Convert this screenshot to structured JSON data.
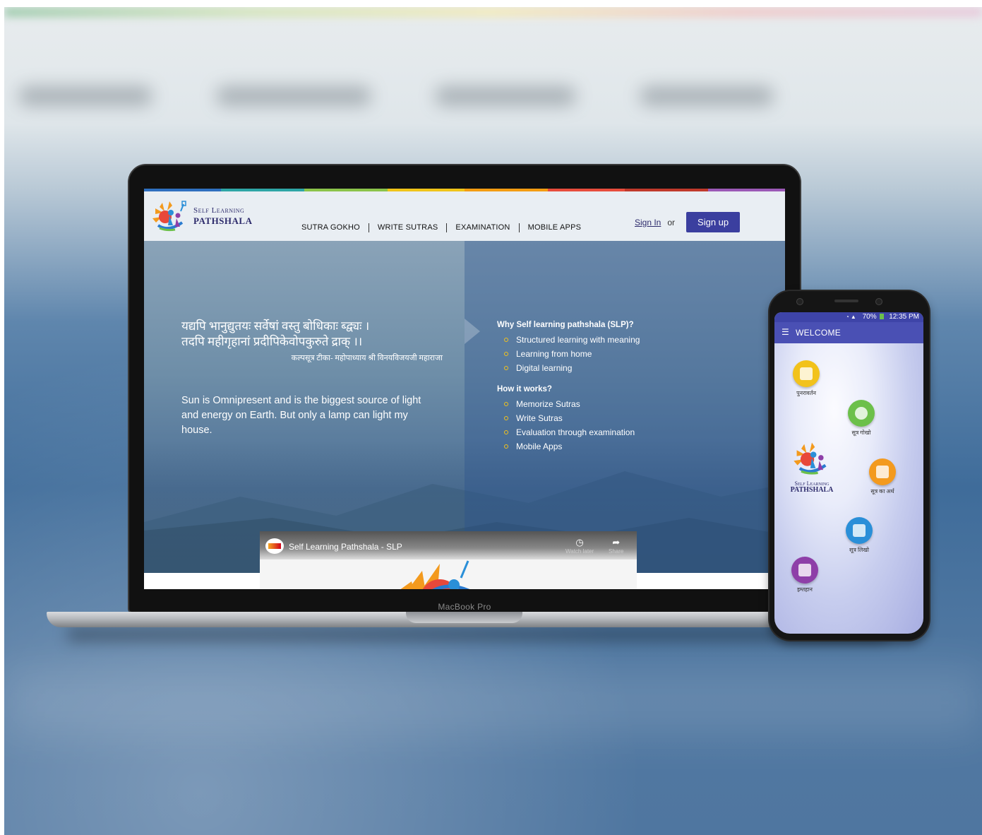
{
  "background": {
    "accent": "#3f6c9a"
  },
  "laptop": {
    "brand_label": "MacBook Pro",
    "site": {
      "logo": {
        "line1": "Self Learning",
        "line2": "Pathshala"
      },
      "nav": [
        "SUTRA GOKHO",
        "WRITE SUTRAS",
        "EXAMINATION",
        "MOBILE APPS"
      ],
      "auth": {
        "signin": "Sign In",
        "or": "or",
        "signup": "Sign up"
      },
      "hero": {
        "sanskrit_line1": "यद्यपि भानुद्युतयः सर्वेषां वस्तु बोधिकाः ब्द्व्यः ।",
        "sanskrit_line2": "तदपि   महीगृहानां   प्रदीपिकेवोपकुरुते  द्राक् ।।",
        "attribution": "कल्पसूत्र टीका- महोपाध्याय श्री विनयविजयजी महाराजा",
        "quote": "Sun is Omnipresent and is the biggest source of light and energy on Earth. But only a lamp can light my house."
      },
      "why": {
        "heading": "Why Self learning pathshala (SLP)?",
        "items": [
          "Structured learning with meaning",
          "Learning from home",
          "Digital learning"
        ]
      },
      "how": {
        "heading": "How it works?",
        "items": [
          "Memorize Sutras",
          "Write Sutras",
          "Evaluation through examination",
          "Mobile Apps"
        ]
      },
      "video": {
        "title": "Self Learning Pathshala - SLP",
        "watch_later": "Watch later",
        "share": "Share"
      },
      "colors": {
        "signup_bg": "#3b3f9f",
        "bullet": "#f2c21b",
        "logo_text": "#2c2a6b"
      }
    }
  },
  "phone": {
    "status": {
      "battery": "70%",
      "time": "12:35 PM"
    },
    "app_bar_title": "WELCOME",
    "logo": {
      "line1": "Self Learning",
      "line2": "Pathshala"
    },
    "tiles": [
      {
        "label": "पुनरावर्तन",
        "icon": "book-icon",
        "color": "#f2c21b"
      },
      {
        "label": "सूत्र गोखो",
        "icon": "reader-icon",
        "color": "#6cc04a"
      },
      {
        "label": "सूत्र का अर्थ",
        "icon": "search-doc-icon",
        "color": "#f39a1e"
      },
      {
        "label": "सूत्र लिखो",
        "icon": "write-icon",
        "color": "#2a8fd8"
      },
      {
        "label": "इम्तहान",
        "icon": "exam-icon",
        "color": "#8e3fa8"
      }
    ]
  }
}
